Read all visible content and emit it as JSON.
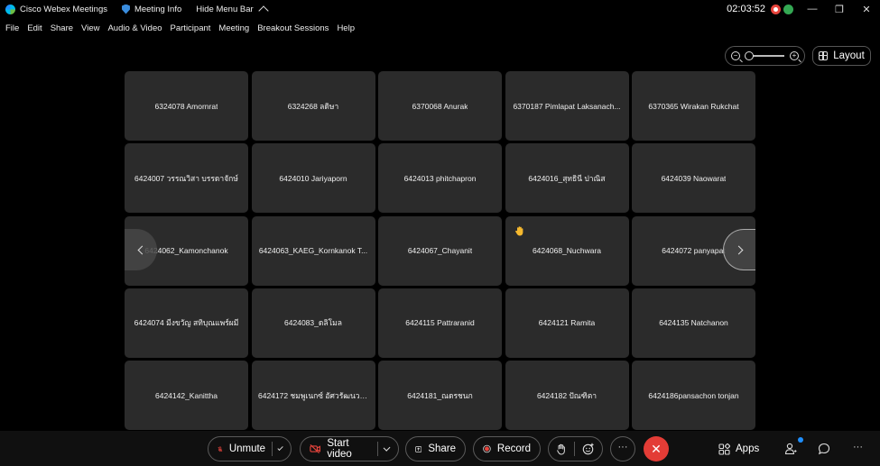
{
  "titlebar": {
    "app_name": "Cisco Webex Meetings",
    "meeting_info": "Meeting Info",
    "hide_menu": "Hide Menu Bar",
    "clock": "02:03:52",
    "minimize": "—",
    "restore": "❐",
    "close": "✕"
  },
  "menu": [
    "File",
    "Edit",
    "Share",
    "View",
    "Audio & Video",
    "Participant",
    "Meeting",
    "Breakout Sessions",
    "Help"
  ],
  "layout_label": "Layout",
  "zoom": {
    "minus": "−",
    "plus": "+"
  },
  "tiles": [
    "6324078 Amornrat",
    "6324268 ลดิษา",
    "6370068 Anurak",
    "6370187 Pimlapat Laksanach...",
    "6370365 Wirakan Rukchat",
    "6424007 วรรณวิสา บรรดาจักษ์",
    "6424010 Jariyaporn",
    "6424013 phitchapron",
    "6424016_สุทธินี ปาณิส",
    "6424039 Naowarat",
    "6424062_Kamonchanok",
    "6424063_KAEG_Kornkanok T...",
    "6424067_Chayanit",
    "6424068_Nuchwara",
    "6424072 panyapat",
    "6424074 มีงขวัญ สทิบุณแพร์ผมี",
    "6424083_ดลิโมล",
    "6424115 Pattraranid",
    "6424121 Ramita",
    "6424135 Natchanon",
    "6424142_Kanittha",
    "6424172 ชมพูเนกซ์ อัศวรัฒนวงศ์",
    "6424181_ณดรชนก",
    "6424182 ปัณฑิตา",
    "6424186pansachon tonjan"
  ],
  "toolbar": {
    "unmute": "Unmute",
    "start_video": "Start video",
    "share": "Share",
    "record": "Record",
    "more": "···",
    "end": "✕",
    "apps": "Apps",
    "overflow": "···"
  },
  "colors": {
    "tile_bg": "#2b2b2b",
    "end_call": "#e33c36",
    "record_dot": "#e6443c",
    "notification": "#1f8fff"
  }
}
